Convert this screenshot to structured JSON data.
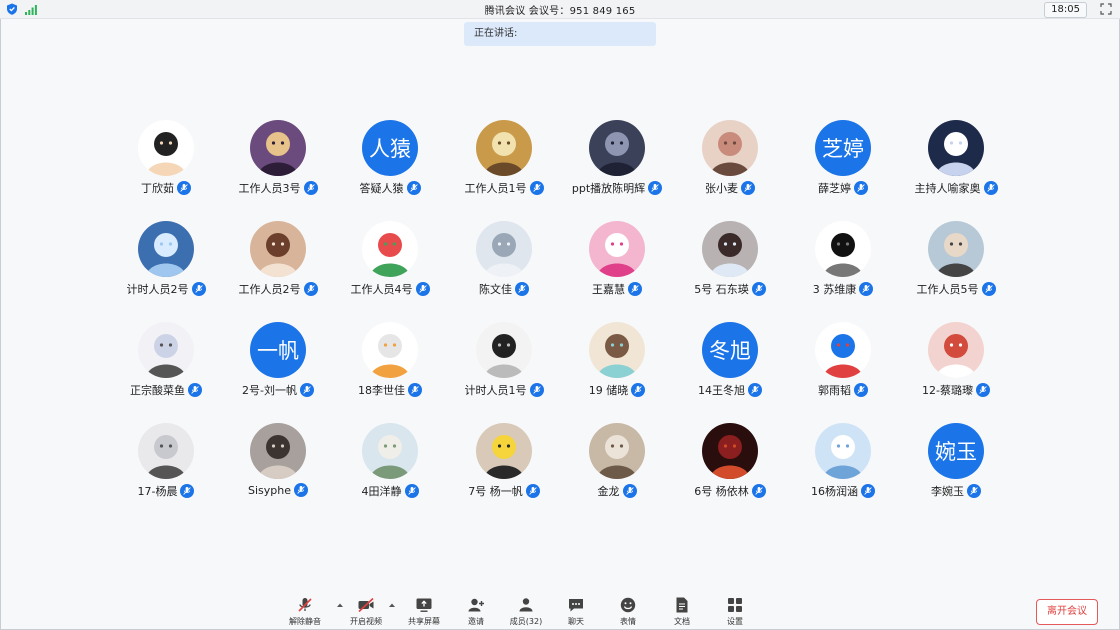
{
  "window": {
    "title": "腾讯会议 会议号：951 849 165",
    "clock": "18:05"
  },
  "speaking_banner": "正在讲话:",
  "participants": [
    {
      "name": "丁欣茹",
      "avatar": "cartoon-boy"
    },
    {
      "name": "工作人员3号",
      "avatar": "anime-girl-purple"
    },
    {
      "name": "答疑人猿",
      "avatar": "text",
      "avatar_text": "人猿"
    },
    {
      "name": "工作人员1号",
      "avatar": "cartoon-deer"
    },
    {
      "name": "ppt播放陈明辉",
      "avatar": "anime-character-dark"
    },
    {
      "name": "张小麦",
      "avatar": "girl-photo"
    },
    {
      "name": "薛芝婷",
      "avatar": "text",
      "avatar_text": "芝婷"
    },
    {
      "name": "主持人喻家奥",
      "avatar": "white-cat-anime"
    },
    {
      "name": "计时人员2号",
      "avatar": "blue-anime-scene"
    },
    {
      "name": "工作人员2号",
      "avatar": "woman-photo"
    },
    {
      "name": "工作人员4号",
      "avatar": "watermelon-cartoon"
    },
    {
      "name": "陈文佳",
      "avatar": "text-image-light"
    },
    {
      "name": "王嘉慧",
      "avatar": "hello-kitty"
    },
    {
      "name": "5号 石东瑛",
      "avatar": "masked-girl"
    },
    {
      "name": "3 苏维康",
      "avatar": "bw-girl"
    },
    {
      "name": "工作人员5号",
      "avatar": "girl-beach"
    },
    {
      "name": "正宗酸菜鱼",
      "avatar": "cat-cartoon"
    },
    {
      "name": "2号-刘一帆",
      "avatar": "text",
      "avatar_text": "一帆"
    },
    {
      "name": "18李世佳",
      "avatar": "geese"
    },
    {
      "name": "计时人员1号",
      "avatar": "manga-sketch"
    },
    {
      "name": "19 储晓",
      "avatar": "anime-girl-mask"
    },
    {
      "name": "14王冬旭",
      "avatar": "text",
      "avatar_text": "冬旭"
    },
    {
      "name": "郭雨韬",
      "avatar": "small-figure"
    },
    {
      "name": "12-蔡璐瓈",
      "avatar": "red-anime"
    },
    {
      "name": "17-杨晨",
      "avatar": "teddy-bear"
    },
    {
      "name": "Sisyphe",
      "avatar": "person-photo"
    },
    {
      "name": "4田洋静",
      "avatar": "painting-figure"
    },
    {
      "name": "7号 杨一帆",
      "avatar": "pikachu"
    },
    {
      "name": "金龙",
      "avatar": "furry-animal"
    },
    {
      "name": "6号 杨依林",
      "avatar": "dark-red"
    },
    {
      "name": "16杨润涵",
      "avatar": "sky-cloud"
    },
    {
      "name": "李婉玉",
      "avatar": "text",
      "avatar_text": "婉玉"
    }
  ],
  "toolbar": {
    "mute": "解除静音",
    "video": "开启视频",
    "share": "共享屏幕",
    "invite": "邀请",
    "members": "成员(32)",
    "chat": "聊天",
    "reactions": "表情",
    "docs": "文档",
    "settings": "设置",
    "leave": "离开会议"
  },
  "colors": {
    "accent": "#1b74e8",
    "leave": "#e0403f",
    "banner": "#dbe9fb"
  }
}
